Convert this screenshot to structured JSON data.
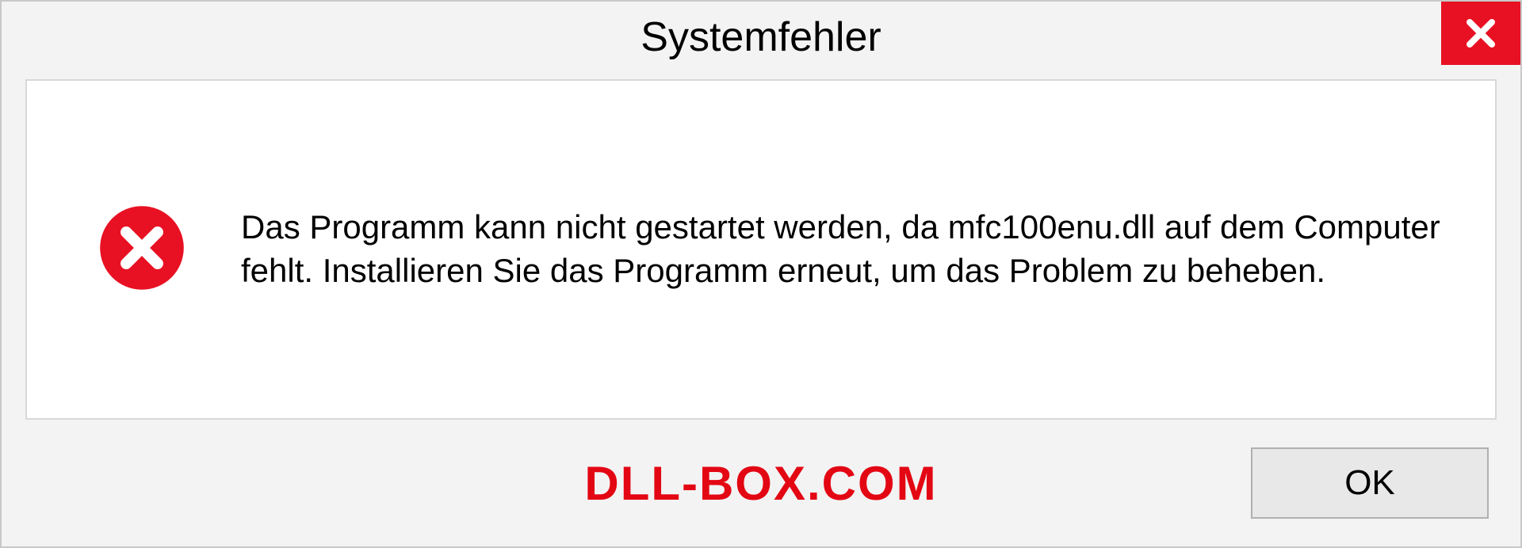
{
  "dialog": {
    "title": "Systemfehler",
    "message": "Das Programm kann nicht gestartet werden, da mfc100enu.dll auf dem Computer fehlt. Installieren Sie das Programm erneut, um das Problem zu beheben.",
    "ok_label": "OK"
  },
  "watermark": "DLL-BOX.COM"
}
